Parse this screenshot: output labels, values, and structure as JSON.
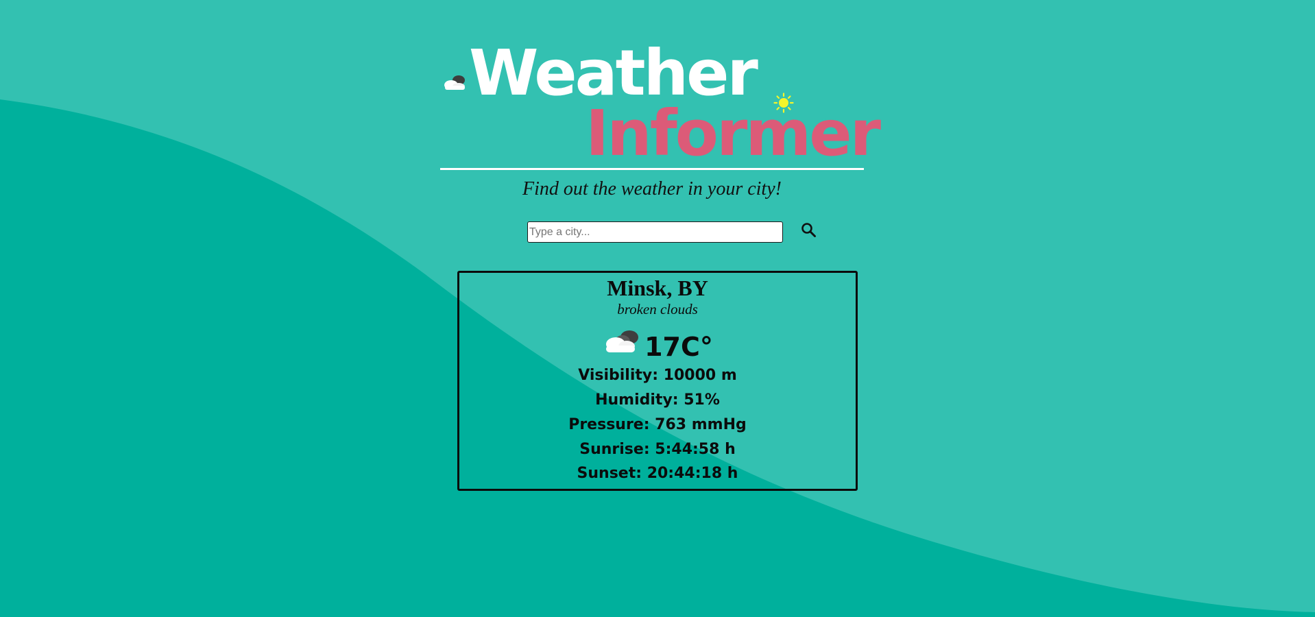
{
  "header": {
    "title_line1": "Weather",
    "title_line2": "Informer",
    "subtitle": "Find out the weather in your city!",
    "cloud_icon": "cloud-icon",
    "sun_icon": "sun-icon"
  },
  "search": {
    "placeholder": "Type a city...",
    "value": "",
    "button_icon": "search-icon"
  },
  "weather": {
    "city": "Minsk, BY",
    "description": "broken clouds",
    "icon": "broken-clouds-icon",
    "temperature": "17C°",
    "visibility": "Visibility: 10000 m",
    "humidity": "Humidity: 51%",
    "pressure": "Pressure: 763 mmHg",
    "sunrise": "Sunrise: 5:44:58 h",
    "sunset": "Sunset: 20:44:18 h"
  },
  "colors": {
    "background_light": "#33c1b1",
    "background_wave": "#00b09c",
    "title_white": "#ffffff",
    "title_pink": "#dc5b78",
    "sun_yellow": "#f5f52a",
    "text_dark": "#0b0b0b"
  }
}
